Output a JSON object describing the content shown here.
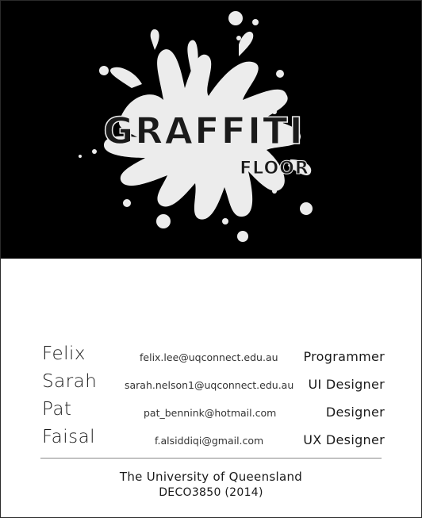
{
  "logo": {
    "title": "GRAFFITI",
    "subtitle": "FLOOR",
    "splash_color": "#ececec",
    "background_color": "#000000"
  },
  "team": [
    {
      "name": "Felix",
      "email": "felix.lee@uqconnect.edu.au",
      "role": "Programmer"
    },
    {
      "name": "Sarah",
      "email": "sarah.nelson1@uqconnect.edu.au",
      "role": "UI Designer"
    },
    {
      "name": "Pat",
      "email": "pat_bennink@hotmail.com",
      "role": "Designer"
    },
    {
      "name": "Faisal",
      "email": "f.alsiddiqi@gmail.com",
      "role": "UX Designer"
    }
  ],
  "footer": {
    "institution": "The University of Queensland",
    "course": "DECO3850 (2014)"
  }
}
